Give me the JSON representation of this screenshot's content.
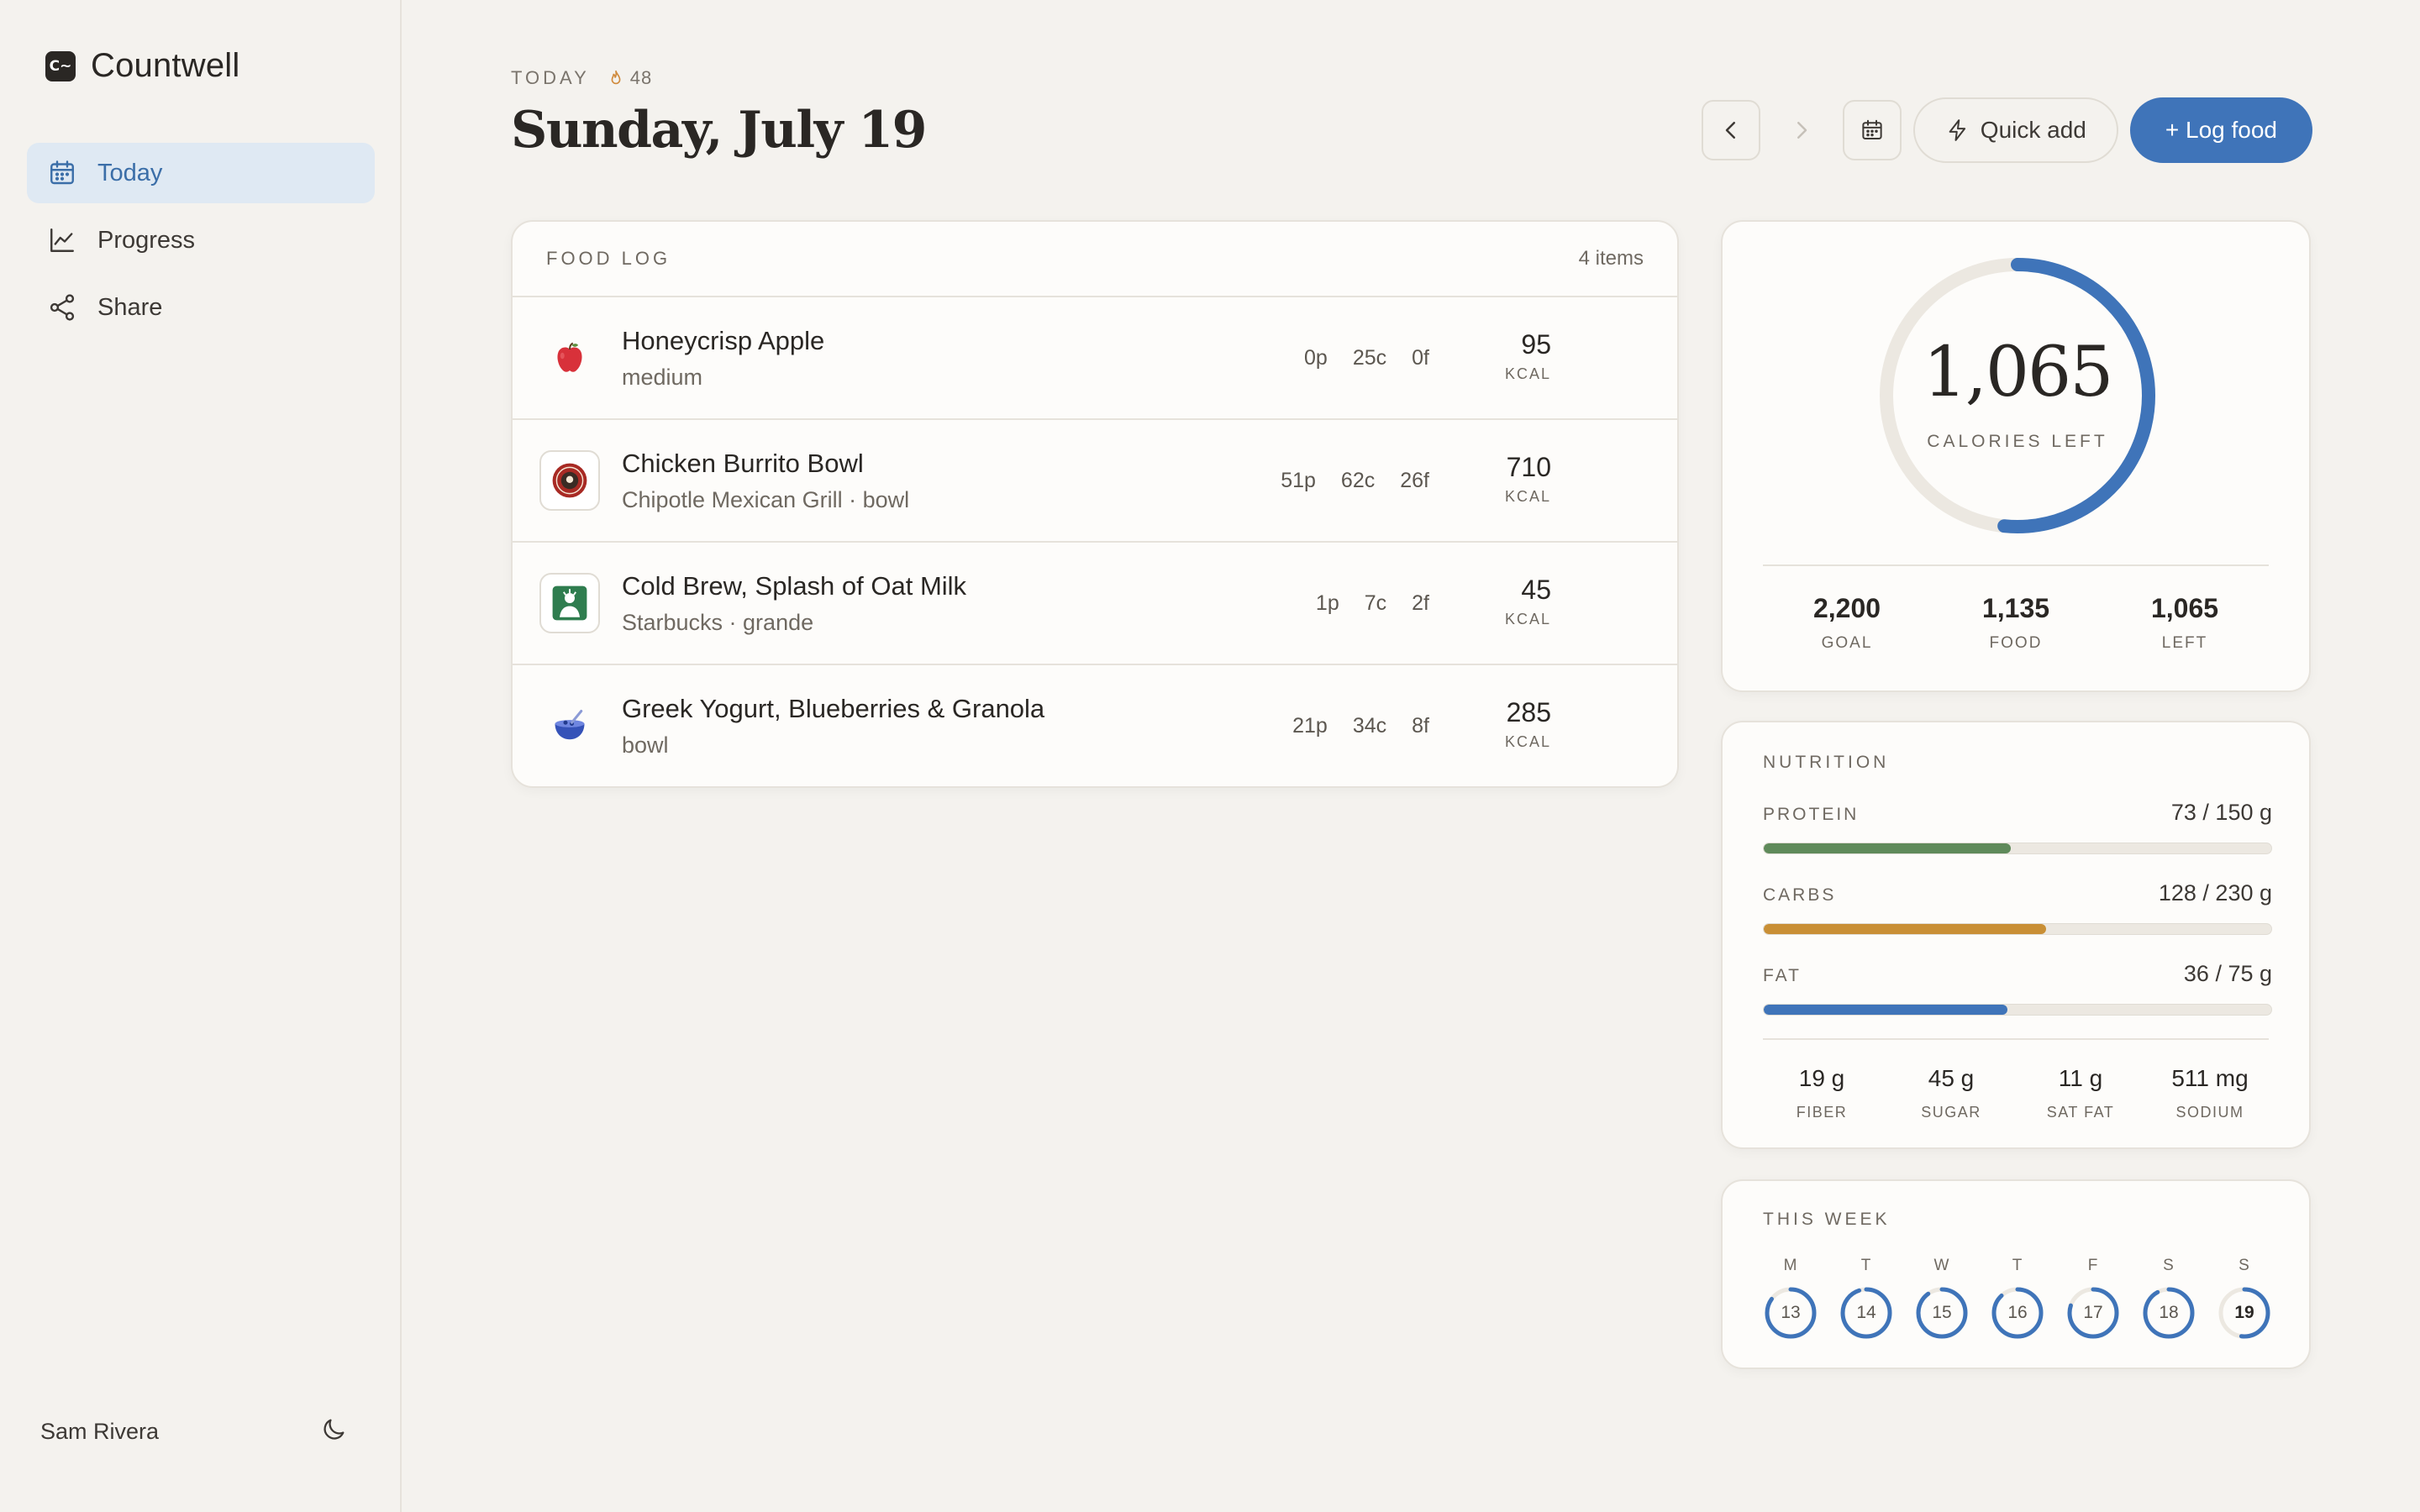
{
  "app": {
    "name": "Countwell",
    "logo_text": "C~"
  },
  "sidebar": {
    "items": [
      {
        "label": "Today",
        "icon": "calendar-icon",
        "active": true
      },
      {
        "label": "Progress",
        "icon": "line-chart-icon",
        "active": false
      },
      {
        "label": "Share",
        "icon": "share-icon",
        "active": false
      }
    ],
    "user_name": "Sam Rivera",
    "theme_toggle_icon": "moon-icon"
  },
  "header": {
    "today_label": "TODAY",
    "streak": "48",
    "date": "Sunday, July 19"
  },
  "toolbar": {
    "prev_icon": "chevron-left-icon",
    "next_icon": "chevron-right-icon",
    "calendar_icon": "calendar-icon",
    "quick_add_label": "Quick add",
    "log_food_label": "+ Log food"
  },
  "food_log": {
    "title": "FOOD LOG",
    "count": "4 items",
    "entries": [
      {
        "name": "Honeycrisp Apple",
        "sub": "medium",
        "p": "0p",
        "c": "25c",
        "f": "0f",
        "kcal": "95",
        "unit": "KCAL",
        "icon": "apple-icon"
      },
      {
        "name": "Chicken Burrito Bowl",
        "sub": "Chipotle Mexican Grill · bowl",
        "p": "51p",
        "c": "62c",
        "f": "26f",
        "kcal": "710",
        "unit": "KCAL",
        "icon": "chipotle-logo-icon"
      },
      {
        "name": "Cold Brew, Splash of Oat Milk",
        "sub": "Starbucks · grande",
        "p": "1p",
        "c": "7c",
        "f": "2f",
        "kcal": "45",
        "unit": "KCAL",
        "icon": "starbucks-logo-icon"
      },
      {
        "name": "Greek Yogurt, Blueberries & Granola",
        "sub": "bowl",
        "p": "21p",
        "c": "34c",
        "f": "8f",
        "kcal": "285",
        "unit": "KCAL",
        "icon": "yogurt-bowl-icon"
      }
    ]
  },
  "calories": {
    "left_value": "1,065",
    "left_label": "CALORIES LEFT",
    "progress": 0.516,
    "ring_color": "#3f74b9",
    "stats": [
      {
        "value": "2,200",
        "label": "GOAL"
      },
      {
        "value": "1,135",
        "label": "FOOD"
      },
      {
        "value": "1,065",
        "label": "LEFT"
      }
    ]
  },
  "nutrition": {
    "title": "NUTRITION",
    "macros": [
      {
        "name": "PROTEIN",
        "value": "73 / 150 g",
        "fraction": 0.487,
        "color": "#5f8a5a"
      },
      {
        "name": "CARBS",
        "value": "128 / 230 g",
        "fraction": 0.557,
        "color": "#c98f35"
      },
      {
        "name": "FAT",
        "value": "36 / 75 g",
        "fraction": 0.48,
        "color": "#3f74b9"
      }
    ],
    "micros": [
      {
        "value": "19 g",
        "label": "FIBER"
      },
      {
        "value": "45 g",
        "label": "SUGAR"
      },
      {
        "value": "11 g",
        "label": "SAT FAT"
      },
      {
        "value": "511 mg",
        "label": "SODIUM"
      }
    ]
  },
  "week": {
    "title": "THIS WEEK",
    "days": [
      {
        "letter": "M",
        "date": "13",
        "fraction": 0.85,
        "current": false
      },
      {
        "letter": "T",
        "date": "14",
        "fraction": 0.95,
        "current": false
      },
      {
        "letter": "W",
        "date": "15",
        "fraction": 0.9,
        "current": false
      },
      {
        "letter": "T",
        "date": "16",
        "fraction": 0.88,
        "current": false
      },
      {
        "letter": "F",
        "date": "17",
        "fraction": 0.8,
        "current": false
      },
      {
        "letter": "S",
        "date": "18",
        "fraction": 0.92,
        "current": false
      },
      {
        "letter": "S",
        "date": "19",
        "fraction": 0.52,
        "current": true
      }
    ]
  }
}
